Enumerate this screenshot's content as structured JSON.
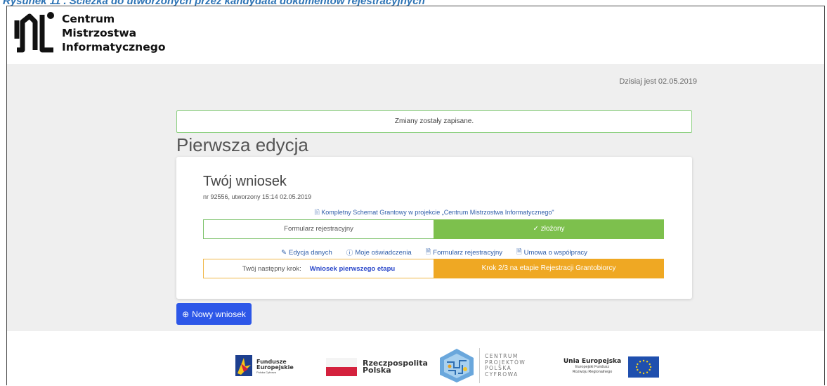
{
  "caption": "Rysunek 11 . Ścieżka do utworzonych przez kandydata dokumentów rejestracyjnych",
  "logo": {
    "line1": "Centrum",
    "line2": "Mistrzostwa",
    "line3": "Informatycznego"
  },
  "date_text": "Dzisiaj jest 02.05.2019",
  "alert_text": "Zmiany zostały zapisane.",
  "page_title": "Pierwsza edycja",
  "card": {
    "title": "Twój wniosek",
    "meta": "nr 92556, utworzony 15:14 02.05.2019",
    "scheme_link": "Kompletny Schemat Grantowy w projekcie „Centrum Mistrzostwa Informatycznego\"",
    "form_label": "Formularz rejestracyjny",
    "form_status": "✓ złożony",
    "links": {
      "edit": "Edycja danych",
      "statements": "Moje oświadczenia",
      "form": "Formularz rejestracyjny",
      "agreement": "Umowa o współpracy"
    },
    "next_step_label": "Twój następny krok:",
    "next_step_link": "Wniosek pierwszego etapu",
    "step_status": "Krok 2/3 na etapie Rejestracji Grantobiorcy"
  },
  "new_button": "Nowy wniosek",
  "footer": {
    "fe": {
      "line1": "Fundusze",
      "line2": "Europejskie",
      "sub": "Polska Cyfrowa"
    },
    "rp": {
      "line1": "Rzeczpospolita",
      "line2": "Polska"
    },
    "cppc": {
      "line1": "CENTRUM",
      "line2": "PROJEKTÓW",
      "line3": "POLSKA",
      "line4": "CYFROWA"
    },
    "ue": {
      "title": "Unia Europejska",
      "sub1": "Europejski Fundusz",
      "sub2": "Rozwoju Regionalnego"
    }
  },
  "colors": {
    "primary": "#2d57e8",
    "success": "#7dc04d",
    "warning": "#efa823",
    "link": "#2f5ea9"
  }
}
